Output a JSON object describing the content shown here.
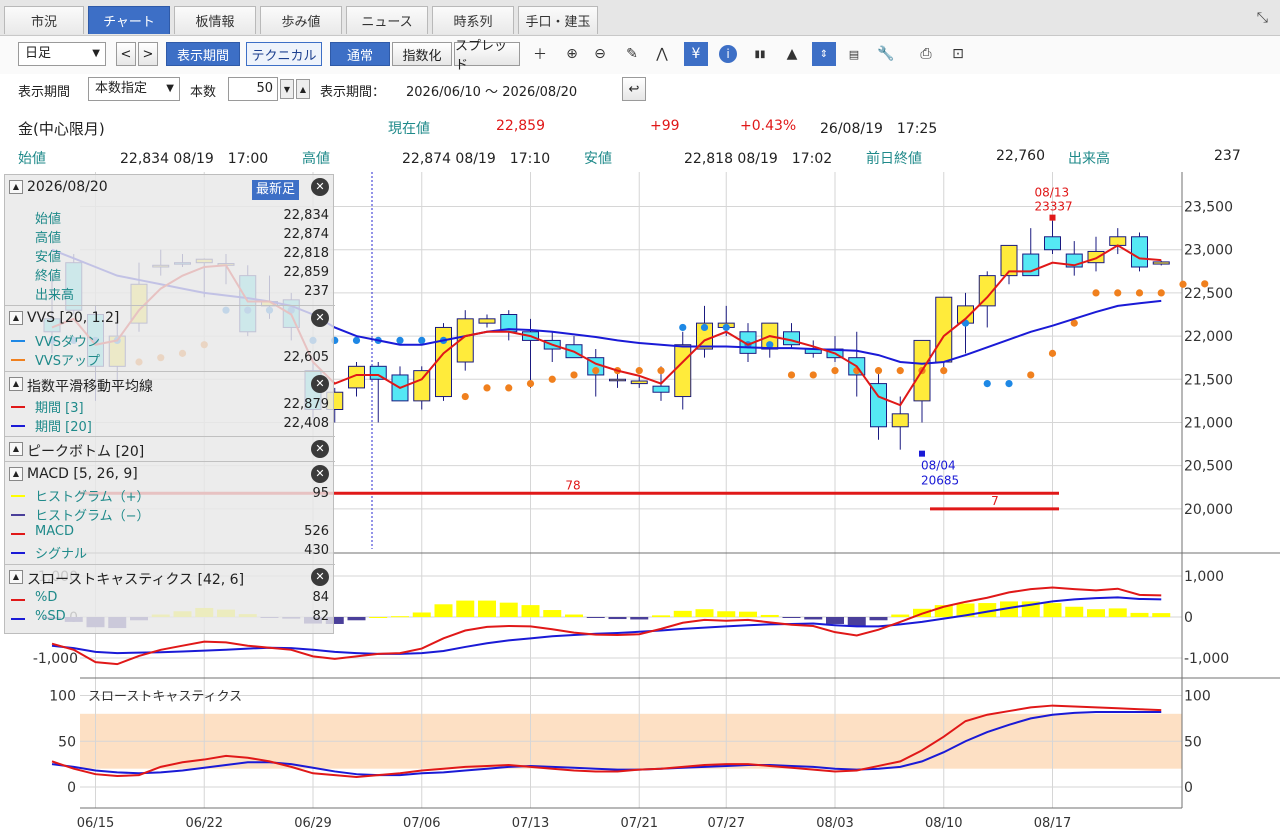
{
  "tabs": [
    {
      "label": "市況",
      "active": false
    },
    {
      "label": "チャート",
      "active": true
    },
    {
      "label": "板情報",
      "active": false
    },
    {
      "label": "歩み値",
      "active": false
    },
    {
      "label": "ニュース",
      "active": false
    },
    {
      "label": "時系列",
      "active": false
    },
    {
      "label": "手口・建玉",
      "active": false
    }
  ],
  "toolbar": {
    "period_select": "日足",
    "prev": "<",
    "next": ">",
    "display_period": "表示期間",
    "technical": "テクニカル",
    "normal": "通常",
    "index": "指数化",
    "spread": "スプレッド"
  },
  "row2": {
    "label_period": "表示期間",
    "count_mode": "本数指定",
    "label_count": "本数",
    "count_value": "50",
    "label_range": "表示期間：",
    "range_text": "2026/06/10 ～ 2026/08/20"
  },
  "info": {
    "name": "金(中心限月)",
    "current_label": "現在値",
    "current_value": "22,859",
    "change": "+99",
    "change_pct": "+0.43%",
    "datetime": "26/08/19　17:25",
    "open_label": "始値",
    "open_value": "22,834 08/19　17:00",
    "high_label": "高値",
    "high_value": "22,874 08/19　17:10",
    "low_label": "安値",
    "low_value": "22,818 08/19　17:02",
    "prev_label": "前日終値",
    "prev_value": "22,760",
    "volume_label": "出来高",
    "volume_value": "237"
  },
  "panel": {
    "date": "2026/08/20",
    "latest_btn": "最新足",
    "ohlc": [
      {
        "k": "始値",
        "v": "22,834"
      },
      {
        "k": "高値",
        "v": "22,874"
      },
      {
        "k": "安値",
        "v": "22,818"
      },
      {
        "k": "終値",
        "v": "22,859"
      },
      {
        "k": "出来高",
        "v": "237"
      }
    ],
    "vvs_title": "VVS [20, 1.2]",
    "vvs_down": "VVSダウン",
    "vvs_up": "VVSアップ",
    "vvs_up_value": "22,605",
    "ema_title": "指数平滑移動平均線",
    "ema3_label": "期間 [3]",
    "ema3_value": "22,879",
    "ema20_label": "期間 [20]",
    "ema20_value": "22,408",
    "peak_title": "ピークボトム [20]",
    "macd_title": "MACD [5, 26, 9]",
    "hist_pos": "ヒストグラム（+）",
    "hist_pos_value": "95",
    "hist_neg": "ヒストグラム（−）",
    "macd_label": "MACD",
    "macd_value": "526",
    "signal_label": "シグナル",
    "signal_value": "430",
    "stoch_title": "スローストキャスティクス [42, 6]",
    "pd_label": "%D",
    "pd_value": "84",
    "psd_label": "%SD",
    "psd_value": "82"
  },
  "colors": {
    "up_body": "#ffeb3b",
    "down_body": "#55e8f4",
    "ema3": "#e01818",
    "ema20": "#1a1ad6",
    "vvs_dot_up": "#f0801e",
    "vvs_dot_down": "#1e88e5",
    "hist_pos": "#ffff00",
    "hist_neg": "#4a3f9a",
    "stoch_band": "#fde0c4"
  },
  "chart_data": {
    "type": "candlestick",
    "x_tick_labels": [
      "06/15",
      "06/22",
      "06/29",
      "07/06",
      "07/13",
      "07/21",
      "07/27",
      "08/03",
      "08/10",
      "08/17"
    ],
    "x_tick_index": [
      2,
      7,
      12,
      17,
      22,
      27,
      31,
      36,
      41,
      46
    ],
    "price_ylim": [
      19500,
      23900
    ],
    "price_ticks": [
      20000,
      20500,
      21000,
      21500,
      22000,
      22500,
      23000,
      23500
    ],
    "price_tick_labels": [
      "20,000",
      "20,500",
      "21,000",
      "21,500",
      "22,000",
      "22,500",
      "23,000",
      "23,500"
    ],
    "candles": [
      {
        "o": 22200,
        "h": 22700,
        "l": 21800,
        "c": 22050
      },
      {
        "o": 22850,
        "h": 22950,
        "l": 22250,
        "c": 22300
      },
      {
        "o": 22250,
        "h": 22350,
        "l": 21250,
        "c": 21650
      },
      {
        "o": 21650,
        "h": 22250,
        "l": 21400,
        "c": 22000
      },
      {
        "o": 22150,
        "h": 22850,
        "l": 22050,
        "c": 22600
      },
      {
        "o": 22800,
        "h": 23000,
        "l": 22700,
        "c": 22820
      },
      {
        "o": 22850,
        "h": 22950,
        "l": 22800,
        "c": 22840
      },
      {
        "o": 22850,
        "h": 22900,
        "l": 22450,
        "c": 22890
      },
      {
        "o": 22820,
        "h": 22950,
        "l": 22600,
        "c": 22840
      },
      {
        "o": 22700,
        "h": 22820,
        "l": 22000,
        "c": 22050
      },
      {
        "o": 22350,
        "h": 22700,
        "l": 22200,
        "c": 22400
      },
      {
        "o": 22420,
        "h": 22500,
        "l": 21950,
        "c": 22100
      },
      {
        "o": 21600,
        "h": 21750,
        "l": 21050,
        "c": 21150
      },
      {
        "o": 21150,
        "h": 21400,
        "l": 21000,
        "c": 21350
      },
      {
        "o": 21400,
        "h": 21700,
        "l": 21300,
        "c": 21650
      },
      {
        "o": 21650,
        "h": 21700,
        "l": 21000,
        "c": 21500
      },
      {
        "o": 21550,
        "h": 21650,
        "l": 21250,
        "c": 21250
      },
      {
        "o": 21250,
        "h": 21650,
        "l": 21150,
        "c": 21600
      },
      {
        "o": 21300,
        "h": 22150,
        "l": 21250,
        "c": 22100
      },
      {
        "o": 21700,
        "h": 22300,
        "l": 21600,
        "c": 22200
      },
      {
        "o": 22150,
        "h": 22250,
        "l": 22100,
        "c": 22200
      },
      {
        "o": 22250,
        "h": 22300,
        "l": 21950,
        "c": 22050
      },
      {
        "o": 22050,
        "h": 22200,
        "l": 21400,
        "c": 21950
      },
      {
        "o": 21950,
        "h": 22050,
        "l": 21700,
        "c": 21850
      },
      {
        "o": 21900,
        "h": 22000,
        "l": 21800,
        "c": 21750
      },
      {
        "o": 21750,
        "h": 21850,
        "l": 21300,
        "c": 21550
      },
      {
        "o": 21500,
        "h": 21600,
        "l": 21400,
        "c": 21500
      },
      {
        "o": 21450,
        "h": 21550,
        "l": 21400,
        "c": 21480
      },
      {
        "o": 21420,
        "h": 21650,
        "l": 21250,
        "c": 21350
      },
      {
        "o": 21300,
        "h": 22050,
        "l": 21150,
        "c": 21900
      },
      {
        "o": 21850,
        "h": 22350,
        "l": 21750,
        "c": 22150
      },
      {
        "o": 22100,
        "h": 22350,
        "l": 22000,
        "c": 22150
      },
      {
        "o": 22050,
        "h": 22150,
        "l": 21700,
        "c": 21800
      },
      {
        "o": 21850,
        "h": 22150,
        "l": 21750,
        "c": 22150
      },
      {
        "o": 22050,
        "h": 22150,
        "l": 21850,
        "c": 21900
      },
      {
        "o": 21850,
        "h": 21950,
        "l": 21750,
        "c": 21800
      },
      {
        "o": 21850,
        "h": 22000,
        "l": 21700,
        "c": 21750
      },
      {
        "o": 21750,
        "h": 22050,
        "l": 21300,
        "c": 21550
      },
      {
        "o": 21450,
        "h": 21600,
        "l": 20800,
        "c": 20950
      },
      {
        "o": 20950,
        "h": 21300,
        "l": 20685,
        "c": 21100
      },
      {
        "o": 21250,
        "h": 21700,
        "l": 21000,
        "c": 21950
      },
      {
        "o": 21700,
        "h": 22450,
        "l": 21600,
        "c": 22450
      },
      {
        "o": 22150,
        "h": 22500,
        "l": 21800,
        "c": 22350
      },
      {
        "o": 22350,
        "h": 22750,
        "l": 22100,
        "c": 22700
      },
      {
        "o": 22700,
        "h": 23050,
        "l": 22600,
        "c": 23050
      },
      {
        "o": 22950,
        "h": 23250,
        "l": 22800,
        "c": 22700
      },
      {
        "o": 23150,
        "h": 23337,
        "l": 22950,
        "c": 23000
      },
      {
        "o": 22950,
        "h": 23100,
        "l": 22700,
        "c": 22800
      },
      {
        "o": 22850,
        "h": 23150,
        "l": 22750,
        "c": 22980
      },
      {
        "o": 23050,
        "h": 23250,
        "l": 22950,
        "c": 23150
      },
      {
        "o": 23150,
        "h": 23200,
        "l": 22750,
        "c": 22800
      },
      {
        "o": 22834,
        "h": 22874,
        "l": 22818,
        "c": 22859
      }
    ],
    "ema3": [
      22100,
      22200,
      21900,
      21950,
      22300,
      22550,
      22700,
      22800,
      22820,
      22400,
      22400,
      22250,
      21700,
      21450,
      21550,
      21550,
      21400,
      21500,
      21800,
      22000,
      22050,
      22050,
      22000,
      21900,
      21820,
      21680,
      21600,
      21540,
      21450,
      21700,
      21950,
      22050,
      21900,
      22000,
      21950,
      21880,
      21800,
      21650,
      21300,
      21200,
      21600,
      22000,
      22200,
      22450,
      22750,
      22750,
      22850,
      22820,
      22900,
      23050,
      22900,
      22879
    ],
    "ema20": [
      23000,
      22900,
      22800,
      22700,
      22650,
      22600,
      22550,
      22500,
      22470,
      22440,
      22400,
      22350,
      22250,
      22100,
      22000,
      21950,
      21900,
      21900,
      21950,
      22000,
      22050,
      22080,
      22070,
      22050,
      22020,
      21990,
      21950,
      21920,
      21900,
      21880,
      21880,
      21880,
      21870,
      21860,
      21860,
      21850,
      21840,
      21830,
      21780,
      21700,
      21680,
      21700,
      21780,
      21870,
      21960,
      22050,
      22120,
      22200,
      22280,
      22350,
      22380,
      22408
    ],
    "vvs_dots": [
      {
        "i": 0,
        "v": 21950,
        "t": "down"
      },
      {
        "i": 1,
        "v": 21950,
        "t": "down"
      },
      {
        "i": 2,
        "v": 21950,
        "t": "down"
      },
      {
        "i": 3,
        "v": 21950,
        "t": "down"
      },
      {
        "i": 4,
        "v": 21700,
        "t": "up"
      },
      {
        "i": 5,
        "v": 21750,
        "t": "up"
      },
      {
        "i": 6,
        "v": 21800,
        "t": "up"
      },
      {
        "i": 7,
        "v": 21900,
        "t": "up"
      },
      {
        "i": 8,
        "v": 22300,
        "t": "down"
      },
      {
        "i": 9,
        "v": 22300,
        "t": "down"
      },
      {
        "i": 10,
        "v": 22300,
        "t": "down"
      },
      {
        "i": 11,
        "v": 22300,
        "t": "down"
      },
      {
        "i": 12,
        "v": 21950,
        "t": "down"
      },
      {
        "i": 13,
        "v": 21950,
        "t": "down"
      },
      {
        "i": 14,
        "v": 21950,
        "t": "down"
      },
      {
        "i": 15,
        "v": 21950,
        "t": "down"
      },
      {
        "i": 16,
        "v": 21950,
        "t": "down"
      },
      {
        "i": 17,
        "v": 21950,
        "t": "down"
      },
      {
        "i": 18,
        "v": 21950,
        "t": "down"
      },
      {
        "i": 19,
        "v": 21300,
        "t": "up"
      },
      {
        "i": 20,
        "v": 21400,
        "t": "up"
      },
      {
        "i": 21,
        "v": 21400,
        "t": "up"
      },
      {
        "i": 22,
        "v": 21450,
        "t": "up"
      },
      {
        "i": 23,
        "v": 21500,
        "t": "up"
      },
      {
        "i": 24,
        "v": 21550,
        "t": "up"
      },
      {
        "i": 25,
        "v": 21600,
        "t": "up"
      },
      {
        "i": 26,
        "v": 21600,
        "t": "up"
      },
      {
        "i": 27,
        "v": 21600,
        "t": "up"
      },
      {
        "i": 28,
        "v": 21600,
        "t": "up"
      },
      {
        "i": 29,
        "v": 22100,
        "t": "down"
      },
      {
        "i": 30,
        "v": 22100,
        "t": "down"
      },
      {
        "i": 31,
        "v": 22100,
        "t": "down"
      },
      {
        "i": 32,
        "v": 21900,
        "t": "down"
      },
      {
        "i": 33,
        "v": 21900,
        "t": "down"
      },
      {
        "i": 34,
        "v": 21550,
        "t": "up"
      },
      {
        "i": 35,
        "v": 21550,
        "t": "up"
      },
      {
        "i": 36,
        "v": 21600,
        "t": "up"
      },
      {
        "i": 37,
        "v": 21600,
        "t": "up"
      },
      {
        "i": 38,
        "v": 21600,
        "t": "up"
      },
      {
        "i": 39,
        "v": 21600,
        "t": "up"
      },
      {
        "i": 40,
        "v": 21600,
        "t": "up"
      },
      {
        "i": 41,
        "v": 21600,
        "t": "up"
      },
      {
        "i": 42,
        "v": 22150,
        "t": "down"
      },
      {
        "i": 43,
        "v": 21450,
        "t": "down"
      },
      {
        "i": 44,
        "v": 21450,
        "t": "down"
      },
      {
        "i": 45,
        "v": 21550,
        "t": "up"
      },
      {
        "i": 46,
        "v": 21800,
        "t": "up"
      },
      {
        "i": 47,
        "v": 22150,
        "t": "up"
      },
      {
        "i": 48,
        "v": 22500,
        "t": "up"
      },
      {
        "i": 49,
        "v": 22500,
        "t": "up"
      },
      {
        "i": 50,
        "v": 22500,
        "t": "up"
      },
      {
        "i": 51,
        "v": 22500,
        "t": "up"
      },
      {
        "i": 52,
        "v": 22600,
        "t": "up"
      },
      {
        "i": 53,
        "v": 22605,
        "t": "up"
      }
    ],
    "peak_annotation": {
      "date": "08/13",
      "value": "23337"
    },
    "bottom_annotation": {
      "date": "08/04",
      "value": "20685"
    },
    "level_lines": [
      {
        "label": "78",
        "value": 20180
      },
      {
        "label": "7",
        "value": 20000
      }
    ],
    "macd_ylim": [
      -1250,
      1250
    ],
    "macd_ticks": [
      -1000,
      0,
      1000
    ],
    "macd_tick_labels": [
      "-1,000",
      "0",
      "1,000"
    ],
    "macd": [
      -650,
      -800,
      -1100,
      -1150,
      -950,
      -800,
      -700,
      -600,
      -620,
      -700,
      -750,
      -800,
      -960,
      -1020,
      -960,
      -900,
      -880,
      -770,
      -520,
      -330,
      -240,
      -220,
      -230,
      -300,
      -380,
      -430,
      -440,
      -420,
      -290,
      -140,
      -70,
      -90,
      -70,
      -130,
      -190,
      -220,
      -370,
      -450,
      -310,
      -120,
      80,
      250,
      370,
      470,
      600,
      680,
      720,
      680,
      650,
      690,
      540,
      526
    ],
    "signal": [
      -700,
      -760,
      -850,
      -880,
      -870,
      -860,
      -840,
      -820,
      -800,
      -770,
      -750,
      -760,
      -800,
      -850,
      -880,
      -900,
      -900,
      -880,
      -830,
      -730,
      -640,
      -570,
      -520,
      -470,
      -440,
      -410,
      -390,
      -360,
      -330,
      -290,
      -260,
      -230,
      -200,
      -180,
      -170,
      -160,
      -200,
      -230,
      -230,
      -180,
      -120,
      -40,
      40,
      130,
      220,
      300,
      380,
      430,
      460,
      480,
      440,
      430
    ],
    "hist": [
      -50,
      -120,
      -250,
      -270,
      -80,
      60,
      140,
      220,
      180,
      70,
      -10,
      -40,
      -160,
      -170,
      -80,
      0,
      20,
      110,
      310,
      400,
      400,
      350,
      290,
      170,
      60,
      -20,
      -50,
      -60,
      40,
      150,
      190,
      140,
      130,
      50,
      -20,
      -60,
      -170,
      -220,
      -80,
      60,
      200,
      290,
      330,
      340,
      380,
      380,
      340,
      250,
      190,
      210,
      100,
      95
    ],
    "stoch_ylim": [
      0,
      100
    ],
    "stoch_ticks": [
      0,
      50,
      100
    ],
    "stoch_band": [
      20,
      80
    ],
    "stoch_label": "スローストキャスティクス",
    "pct_d": [
      28,
      20,
      14,
      12,
      13,
      22,
      27,
      30,
      34,
      32,
      28,
      22,
      15,
      13,
      11,
      13,
      15,
      18,
      20,
      22,
      23,
      24,
      22,
      20,
      18,
      17,
      17,
      19,
      20,
      22,
      24,
      25,
      25,
      23,
      21,
      19,
      17,
      18,
      23,
      28,
      40,
      55,
      72,
      79,
      83,
      87,
      89,
      88,
      87,
      86,
      85,
      84
    ],
    "pct_sd": [
      25,
      22,
      18,
      16,
      15,
      16,
      18,
      21,
      24,
      27,
      27,
      25,
      21,
      17,
      14,
      13,
      13,
      15,
      16,
      18,
      20,
      22,
      23,
      22,
      21,
      20,
      19,
      19,
      20,
      21,
      22,
      23,
      24,
      24,
      23,
      22,
      20,
      19,
      20,
      22,
      28,
      38,
      50,
      60,
      68,
      75,
      79,
      81,
      82,
      82,
      82,
      82
    ]
  }
}
